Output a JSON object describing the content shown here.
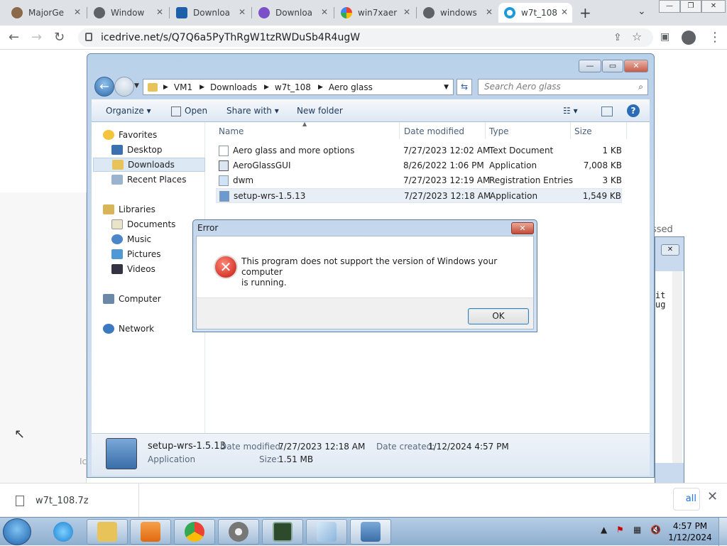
{
  "browser": {
    "tabs": [
      {
        "label": "MajorGe",
        "active": false
      },
      {
        "label": "Window",
        "active": false
      },
      {
        "label": "Downloa",
        "active": false
      },
      {
        "label": "Downloa",
        "active": false
      },
      {
        "label": "win7xaer",
        "active": false
      },
      {
        "label": "windows",
        "active": false
      },
      {
        "label": "w7t_108",
        "active": true
      }
    ],
    "new_tab": "+",
    "url": "icedrive.net/s/Q7Q6a5PyThRgW1tzRWDuSb4R4ugW"
  },
  "webpage": {
    "fragment_right_1": "ssed",
    "fragment_right_2": "it",
    "fragment_right_3": "ug",
    "fragment_left": "Ic"
  },
  "download_bar": {
    "file_name": "w7t_108.7z",
    "show_all": "all"
  },
  "explorer": {
    "breadcrumb": [
      "VM1",
      "Downloads",
      "w7t_108",
      "Aero glass"
    ],
    "search_placeholder": "Search Aero glass",
    "commands": {
      "organize": "Organize",
      "open": "Open",
      "share_with": "Share with",
      "new_folder": "New folder"
    },
    "nav": {
      "favorites": "Favorites",
      "desktop": "Desktop",
      "downloads": "Downloads",
      "recent_places": "Recent Places",
      "libraries": "Libraries",
      "documents": "Documents",
      "music": "Music",
      "pictures": "Pictures",
      "videos": "Videos",
      "computer": "Computer",
      "network": "Network"
    },
    "columns": {
      "name": "Name",
      "date": "Date modified",
      "type": "Type",
      "size": "Size"
    },
    "files": [
      {
        "name": "Aero glass and more options",
        "date": "7/27/2023 12:02 AM",
        "type": "Text Document",
        "size": "1 KB"
      },
      {
        "name": "AeroGlassGUI",
        "date": "8/26/2022 1:06 PM",
        "type": "Application",
        "size": "7,008 KB"
      },
      {
        "name": "dwm",
        "date": "7/27/2023 12:19 AM",
        "type": "Registration Entries",
        "size": "3 KB"
      },
      {
        "name": "setup-wrs-1.5.13",
        "date": "7/27/2023 12:18 AM",
        "type": "Application",
        "size": "1,549 KB"
      }
    ],
    "details": {
      "name": "setup-wrs-1.5.13",
      "type": "Application",
      "date_modified_label": "Date modified:",
      "date_modified": "7/27/2023 12:18 AM",
      "size_label": "Size:",
      "size": "1.51 MB",
      "date_created_label": "Date created:",
      "date_created": "1/12/2024 4:57 PM"
    }
  },
  "error_dialog": {
    "title": "Error",
    "message_line1": "This program does not support the version of Windows your computer",
    "message_line2": "is running.",
    "ok_label": "OK"
  },
  "taskbar": {
    "time": "4:57 PM",
    "date": "1/12/2024"
  }
}
